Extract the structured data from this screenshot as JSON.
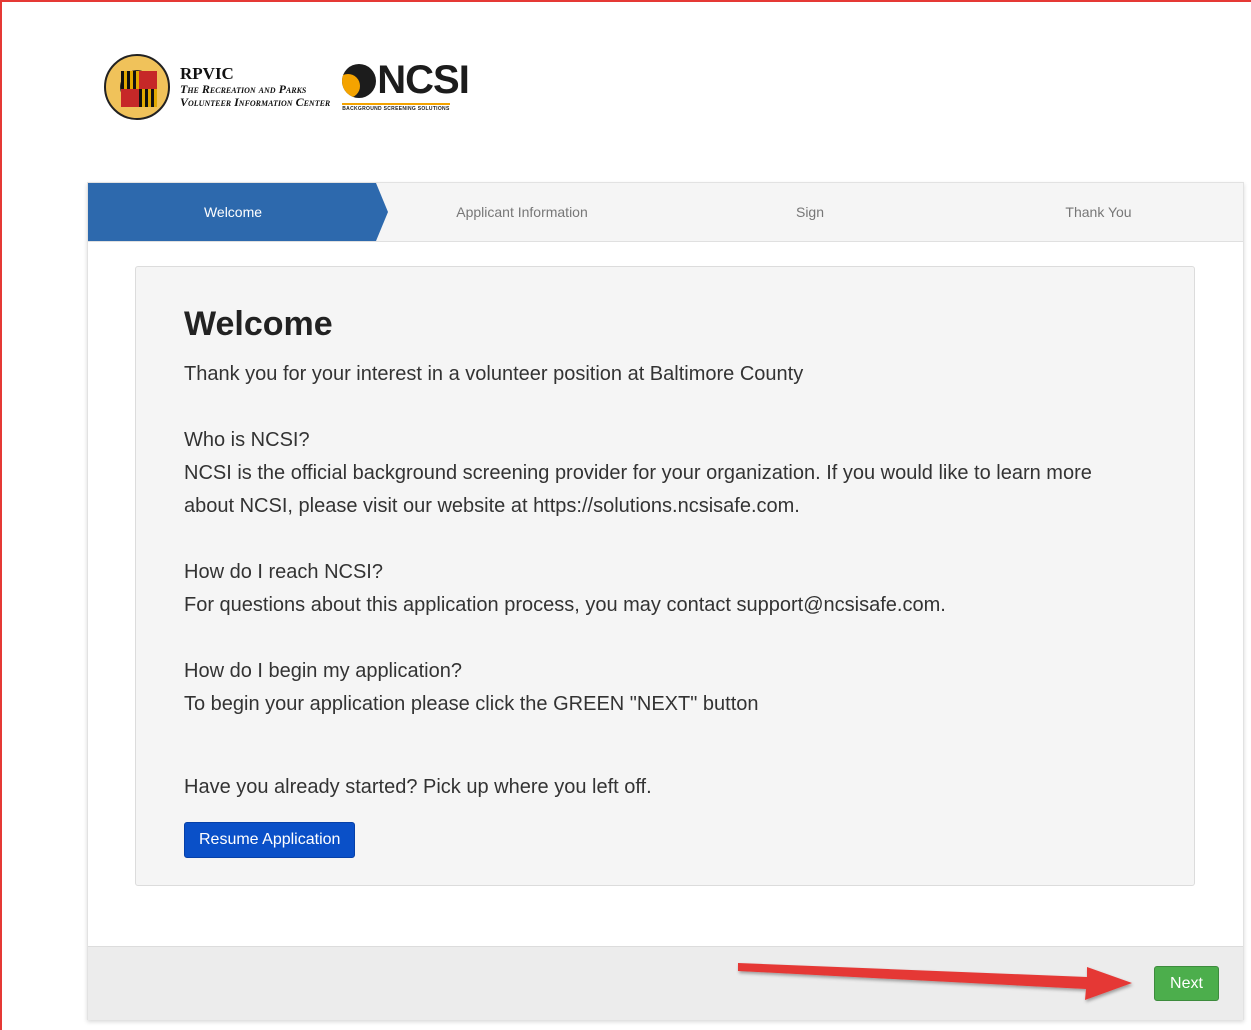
{
  "header": {
    "org_short": "RPVIC",
    "org_line1": "The Recreation and Parks",
    "org_line2": "Volunteer Information Center",
    "ncsi_word": "NCSI",
    "ncsi_tagline": "BACKGROUND SCREENING SOLUTIONS"
  },
  "steps": [
    {
      "label": "Welcome",
      "active": true
    },
    {
      "label": "Applicant Information",
      "active": false
    },
    {
      "label": "Sign",
      "active": false
    },
    {
      "label": "Thank You",
      "active": false
    }
  ],
  "welcome": {
    "title": "Welcome",
    "intro": "Thank you for your interest in a volunteer position at Baltimore County",
    "q1": "Who is NCSI?",
    "a1": "NCSI is the official background screening provider for your organization. If you would like to learn more about NCSI, please visit our website at https://solutions.ncsisafe.com.",
    "q2": "How do I reach NCSI?",
    "a2": "For questions about this application process, you may contact support@ncsisafe.com.",
    "q3": "How do I begin my application?",
    "a3": "To begin your application please click the GREEN \"NEXT\" button",
    "resume_prompt": "Have you already started? Pick up where you left off.",
    "resume_button": "Resume Application"
  },
  "footer": {
    "next_button": "Next"
  },
  "colors": {
    "active_step": "#2d69ad",
    "resume_button": "#0a50c8",
    "next_button": "#4cae4c",
    "annotation_arrow": "#e53935"
  },
  "icons": {
    "seal": "baltimore-county-seal-icon",
    "ncsi_logo": "ncsi-logo-icon",
    "arrow": "annotation-arrow-icon"
  }
}
